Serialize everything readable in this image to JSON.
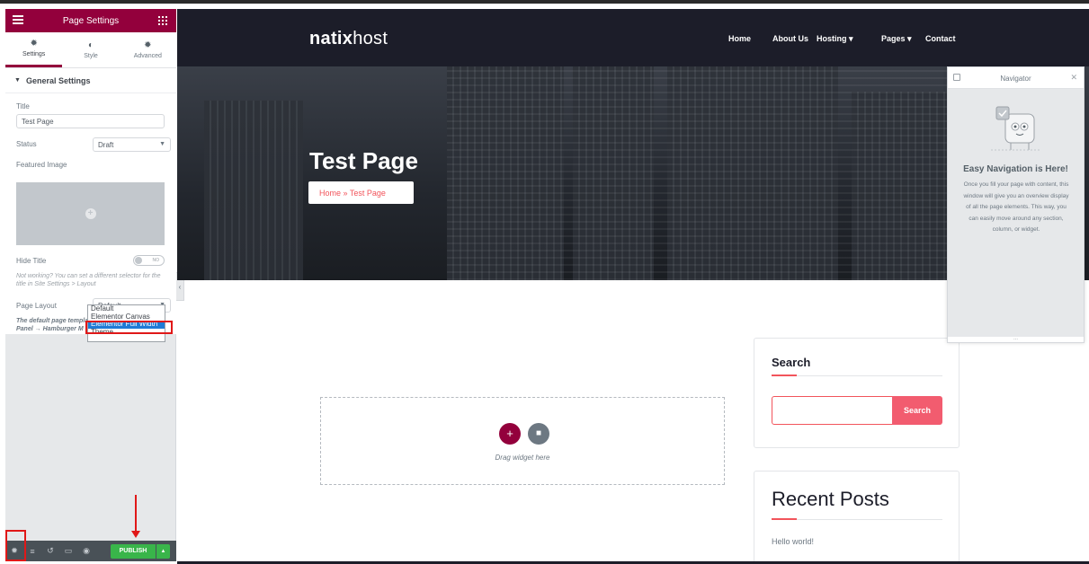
{
  "panel": {
    "title": "Page Settings",
    "tabs": [
      {
        "label": "Settings",
        "icon": "gear-icon"
      },
      {
        "label": "Style",
        "icon": "contrast-icon"
      },
      {
        "label": "Advanced",
        "icon": "gear-icon"
      }
    ],
    "section": "General Settings",
    "fields": {
      "title_label": "Title",
      "title_value": "Test Page",
      "status_label": "Status",
      "status_value": "Draft",
      "featured_label": "Featured Image",
      "hide_title_label": "Hide Title",
      "hide_title_switch": "NO",
      "hide_note": "Not working? You can set a different selector for the title in Site Settings > Layout",
      "layout_label": "Page Layout",
      "layout_value": "Default",
      "layout_note_a": "The default page templat",
      "layout_note_b": "Panel → Hamburger M"
    },
    "layout_options": [
      "Default",
      "Elementor Canvas",
      "Elementor Full Width",
      "Theme"
    ],
    "footer": {
      "publish": "PUBLISH"
    }
  },
  "site": {
    "logo_bold": "natix",
    "logo_light": "host",
    "nav": [
      "Home",
      "About Us",
      "Hosting ▾",
      "Pages ▾",
      "Contact"
    ],
    "hero_title": "Test Page",
    "breadcrumb": "Home  »  Test Page",
    "dropzone_text": "Drag widget here",
    "search_title": "Search",
    "search_button": "Search",
    "recent_title": "Recent Posts",
    "recent_item": "Hello world!"
  },
  "navigator": {
    "title": "Navigator",
    "heading": "Easy Navigation is Here!",
    "text": "Once you fill your page with content, this window will give you an overview display of all the page elements. This way, you can easily move around any section, column, or widget.",
    "foot": "..."
  },
  "colors": {
    "brand": "#93003c",
    "accent": "#f2545b",
    "publish": "#39b54a",
    "header": "#1c1d29"
  }
}
